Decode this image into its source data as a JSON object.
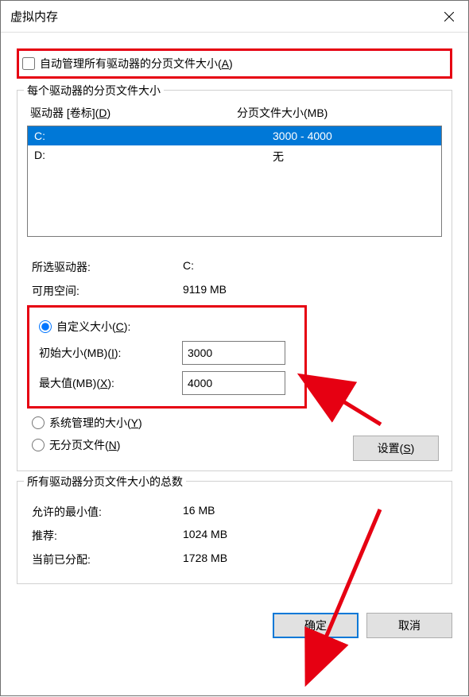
{
  "window": {
    "title": "虚拟内存"
  },
  "autoManage": {
    "label": "自动管理所有驱动器的分页文件大小(",
    "accel": "A",
    "suffix": ")"
  },
  "group1": {
    "title": "每个驱动器的分页文件大小",
    "driveHeader": "驱动器 [卷标](",
    "driveHeaderAccel": "D",
    "driveHeaderSuffix": ")",
    "pagefileHeader": "分页文件大小(MB)",
    "drives": [
      {
        "name": "C:",
        "size": "3000 - 4000",
        "selected": true
      },
      {
        "name": "D:",
        "size": "无",
        "selected": false
      }
    ],
    "selectedDriveLabel": "所选驱动器:",
    "selectedDriveValue": "C:",
    "freeSpaceLabel": "可用空间:",
    "freeSpaceValue": "9119 MB",
    "customSizePrefix": "自定义大小(",
    "customSizeAccel": "C",
    "customSizeSuffix": "):",
    "initialSizeLabel": "初始大小(MB)(",
    "initialSizeAccel": "I",
    "initialSizeSuffix": "):",
    "initialSizeValue": "3000",
    "maxSizeLabel": "最大值(MB)(",
    "maxSizeAccel": "X",
    "maxSizeSuffix": "):",
    "maxSizeValue": "4000",
    "systemManagedPrefix": "系统管理的大小(",
    "systemManagedAccel": "Y",
    "systemManagedSuffix": ")",
    "noPagingPrefix": "无分页文件(",
    "noPagingAccel": "N",
    "noPagingSuffix": ")",
    "setBtnPrefix": "设置(",
    "setBtnAccel": "S",
    "setBtnSuffix": ")"
  },
  "group2": {
    "title": "所有驱动器分页文件大小的总数",
    "minLabel": "允许的最小值:",
    "minValue": "16 MB",
    "recLabel": "推荐:",
    "recValue": "1024 MB",
    "curLabel": "当前已分配:",
    "curValue": "1728 MB"
  },
  "footer": {
    "ok": "确定",
    "cancel": "取消"
  }
}
